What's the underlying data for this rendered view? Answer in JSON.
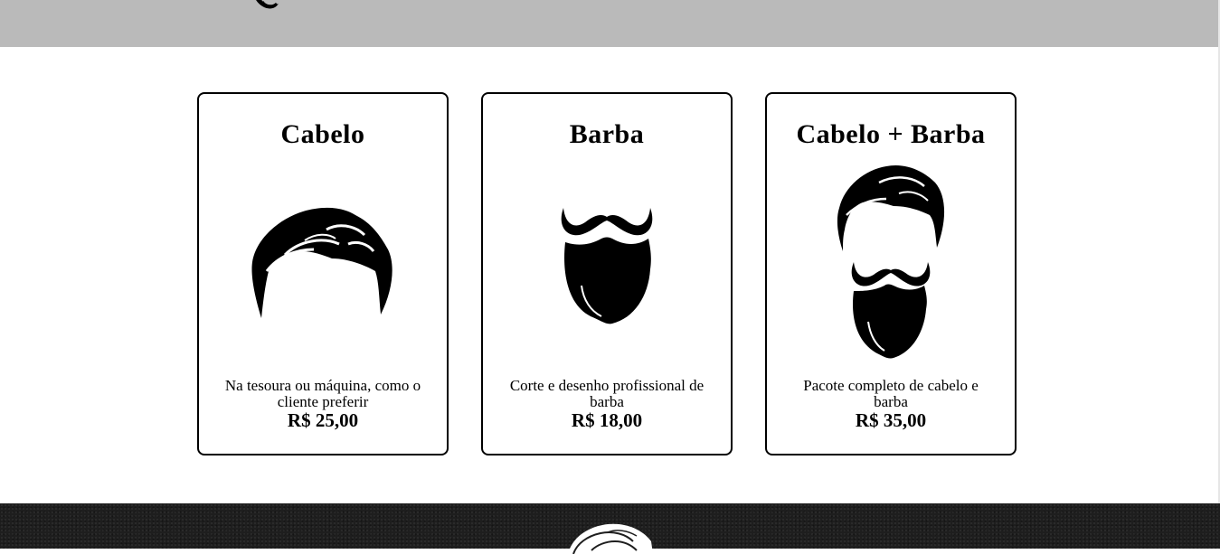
{
  "services": [
    {
      "title": "Cabelo",
      "description": "Na tesoura ou máquina, como o cliente preferir",
      "price": "R$ 25,00",
      "icon": "hair-icon"
    },
    {
      "title": "Barba",
      "description": "Corte e desenho profissional de barba",
      "price": "R$ 18,00",
      "icon": "beard-icon"
    },
    {
      "title": "Cabelo + Barba",
      "description": "Pacote completo de cabelo e barba",
      "price": "R$ 35,00",
      "icon": "hair-and-beard-icon"
    }
  ],
  "colors": {
    "header_bg": "#bababa",
    "footer_bg": "#1e1e1e",
    "card_border": "#000000"
  }
}
